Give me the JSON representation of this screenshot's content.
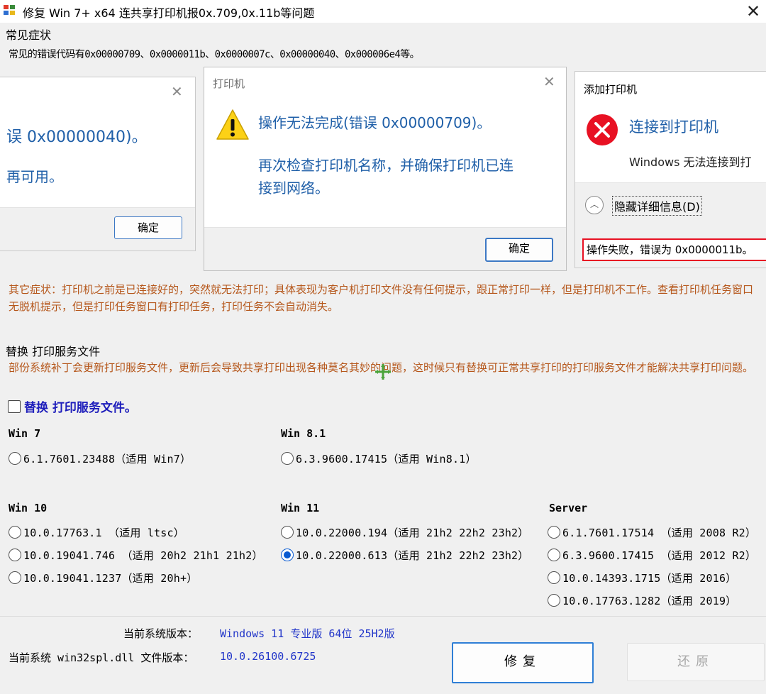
{
  "window": {
    "title": "修复 Win 7+ x64 连共享打印机报0x.709,0x.11b等问题",
    "close_glyph": "✕"
  },
  "symptoms": {
    "group_title": "常见症状",
    "codes_line": "常见的错误代码有0x00000709、0x0000011b、0x0000007c、0x00000040、0x000006e4等。"
  },
  "dialog_left": {
    "line1": "误 0x00000040)。",
    "line2": "再可用。",
    "ok": "确定"
  },
  "dialog_mid": {
    "title": "打印机",
    "line1": "操作无法完成(错误 0x00000709)。",
    "line2": "再次检查打印机名称，并确保打印机已连",
    "line3": "接到网络。",
    "ok": "确定"
  },
  "dialog_right": {
    "title": "添加打印机",
    "heading": "连接到打印机",
    "sub": "Windows 无法连接到打",
    "toggle": "隐藏详细信息(D)",
    "detail": "操作失败，错误为 0x0000011b。"
  },
  "other_symptoms": "其它症状：打印机之前是已连接好的，突然就无法打印；具体表现为客户机打印文件没有任何提示，跟正常打印一样，但是打印机不工作。查看打印机任务窗口无脱机提示，但是打印任务窗口有打印任务，打印任务不会自动消失。",
  "replace": {
    "group_title": "替换 打印服务文件",
    "desc": "部份系统补丁会更新打印服务文件，更新后会导致共享打印出现各种莫名其妙的问题，这时候只有替换可正常共享打印的打印服务文件才能解决共享打印问题。",
    "checkbox_label": "替换 打印服务文件。",
    "checkbox_checked": false
  },
  "versions": {
    "win7": {
      "label": "Win 7",
      "options": [
        {
          "text": "6.1.7601.23488（适用 Win7）",
          "selected": false
        }
      ]
    },
    "win81": {
      "label": "Win 8.1",
      "options": [
        {
          "text": "6.3.9600.17415（适用 Win8.1）",
          "selected": false
        }
      ]
    },
    "win10": {
      "label": "Win 10",
      "options": [
        {
          "text": "10.0.17763.1   （适用 ltsc）",
          "selected": false
        },
        {
          "text": "10.0.19041.746  （适用 20h2 21h1 21h2）",
          "selected": false
        },
        {
          "text": "10.0.19041.1237（适用 20h+）",
          "selected": false
        }
      ]
    },
    "win11": {
      "label": "Win 11",
      "options": [
        {
          "text": "10.0.22000.194（适用 21h2 22h2 23h2）",
          "selected": false
        },
        {
          "text": "10.0.22000.613（适用 21h2 22h2 23h2）",
          "selected": true
        }
      ]
    },
    "server": {
      "label": "Server",
      "options": [
        {
          "text": "6.1.7601.17514  （适用 2008 R2）",
          "selected": false
        },
        {
          "text": "6.3.9600.17415  （适用 2012 R2）",
          "selected": false
        },
        {
          "text": "10.0.14393.1715（适用 2016）",
          "selected": false
        },
        {
          "text": "10.0.17763.1282（适用 2019）",
          "selected": false
        }
      ]
    }
  },
  "status": {
    "os_label": "当前系统版本：",
    "os_value": "Windows 11 专业版  64位 25H2版",
    "dll_label": "当前系统 win32spl.dll 文件版本：",
    "dll_value": "10.0.26100.6725"
  },
  "buttons": {
    "repair": "修复",
    "restore": "还原"
  },
  "colors": {
    "orange_text": "#b5561a",
    "blue_text": "#1f5fa8",
    "link_blue": "#1d1dbb",
    "error_red": "#e81123",
    "focus_blue": "#2f7fd6"
  }
}
